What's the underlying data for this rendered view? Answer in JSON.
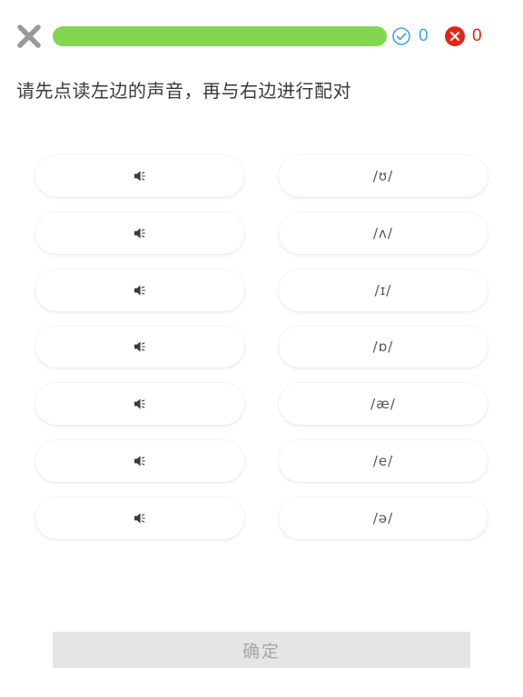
{
  "header": {
    "close_icon": "close-x-icon",
    "progress": {
      "fraction": 1.0,
      "color": "#82d650"
    },
    "correct": {
      "icon": "check-circle-icon",
      "count": "0",
      "color": "#4aa3e0"
    },
    "wrong": {
      "icon": "x-circle-icon",
      "count": "0",
      "color": "#e0261b"
    }
  },
  "instruction": "请先点读左边的声音，再与右边进行配对",
  "left_column": {
    "icon": "speaker-icon",
    "count": 7
  },
  "right_column": {
    "items": [
      "/ʊ/",
      "/ʌ/",
      "/ɪ/",
      "/ɒ/",
      "/æ/",
      "/e/",
      "/ə/"
    ]
  },
  "confirm": {
    "label": "确定",
    "disabled": true
  }
}
